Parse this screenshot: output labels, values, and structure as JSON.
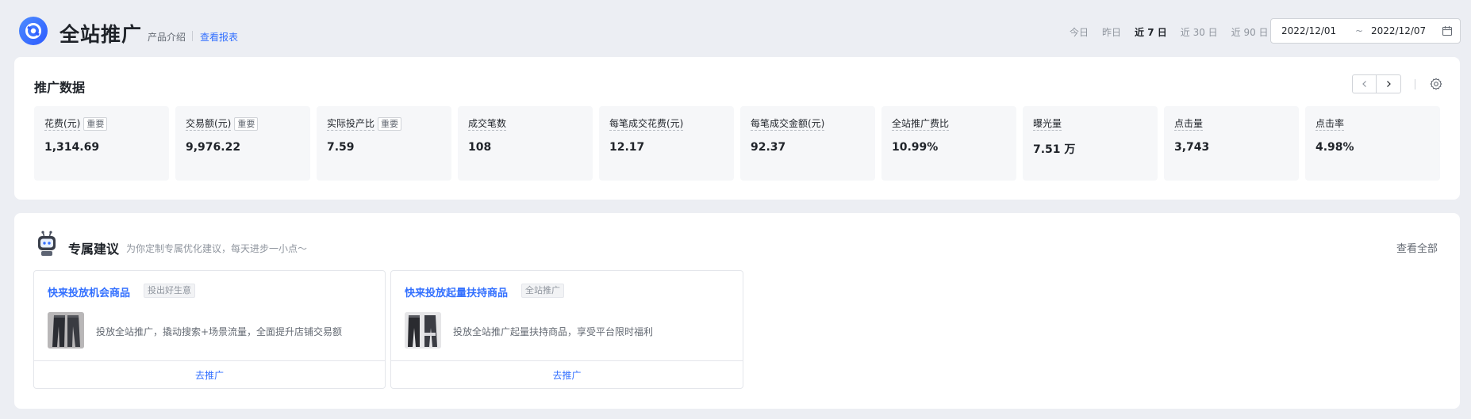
{
  "header": {
    "title": "全站推广",
    "intro_link": "产品介绍",
    "report_link": "查看报表",
    "range_tabs": [
      "今日",
      "昨日",
      "近 7 日",
      "近 30 日",
      "近 90 日"
    ],
    "active_range": "近 7 日",
    "date_start": "2022/12/01",
    "date_sep": "~",
    "date_end": "2022/12/07"
  },
  "data_section": {
    "title": "推广数据",
    "metrics": [
      {
        "label": "花费(元)",
        "tag": "重要",
        "value": "1,314.69"
      },
      {
        "label": "交易额(元)",
        "tag": "重要",
        "value": "9,976.22"
      },
      {
        "label": "实际投产比",
        "tag": "重要",
        "value": "7.59"
      },
      {
        "label": "成交笔数",
        "tag": "",
        "value": "108"
      },
      {
        "label": "每笔成交花费(元)",
        "tag": "",
        "value": "12.17"
      },
      {
        "label": "每笔成交金额(元)",
        "tag": "",
        "value": "92.37"
      },
      {
        "label": "全站推广费比",
        "tag": "",
        "value": "10.99%"
      },
      {
        "label": "曝光量",
        "tag": "",
        "value": "7.51 万"
      },
      {
        "label": "点击量",
        "tag": "",
        "value": "3,743"
      },
      {
        "label": "点击率",
        "tag": "",
        "value": "4.98%"
      }
    ]
  },
  "suggest_section": {
    "title": "专属建议",
    "subtitle": "为你定制专属优化建议，每天进步一小点～",
    "view_all": "查看全部",
    "items": [
      {
        "title": "快来投放机会商品",
        "tag": "投出好生意",
        "desc": "投放全站推广，撬动搜索+场景流量，全面提升店铺交易额",
        "action": "去推广"
      },
      {
        "title": "快来投放起量扶持商品",
        "tag": "全站推广",
        "desc": "投放全站推广起量扶持商品，享受平台限时福利",
        "action": "去推广"
      }
    ]
  },
  "colors": {
    "accent": "#3370ff",
    "background": "#eceef3",
    "metric_bg": "#f6f7f9"
  },
  "icons": [
    "logo-icon",
    "calendar-icon",
    "chevron-left-icon",
    "chevron-right-icon",
    "gear-icon",
    "robot-avatar-icon",
    "pants-product-thumb"
  ]
}
